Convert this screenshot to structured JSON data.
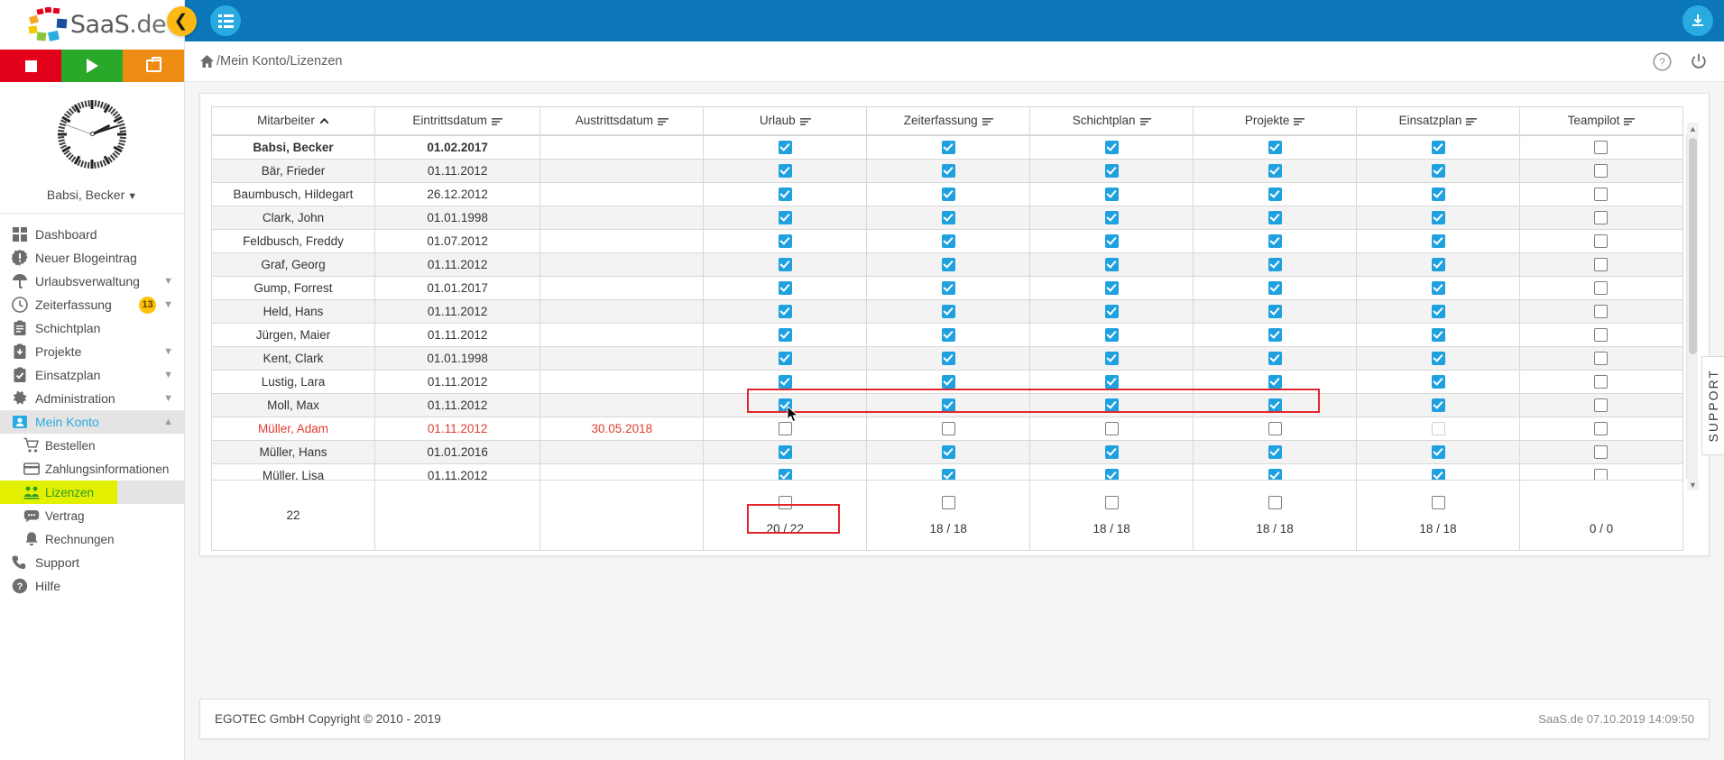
{
  "brand": {
    "name": "SaaS",
    "suffix": ".de"
  },
  "topbar": {
    "collapse_icon": "chevron-left-icon",
    "menu_icon": "list-menu-icon",
    "download_icon": "download-icon"
  },
  "breadcrumb": {
    "home_icon": "home-icon",
    "path": "/Mein Konto/Lizenzen",
    "help_icon": "help-circle-icon",
    "power_icon": "power-icon"
  },
  "sidebar": {
    "action_buttons": [
      {
        "name": "stop-button",
        "icon": "stop-square-icon",
        "color": "#e2001a"
      },
      {
        "name": "play-button",
        "icon": "play-triangle-icon",
        "color": "#2aa82a"
      },
      {
        "name": "briefcase-button",
        "icon": "briefcase-icon",
        "color": "#ef8c13"
      }
    ],
    "clock_icon": "analog-clock-icon",
    "user": "Babsi, Becker",
    "items": [
      {
        "label": "Dashboard",
        "icon": "dashboard-grid-icon",
        "expandable": false,
        "badge": null,
        "active": false,
        "sub": false
      },
      {
        "label": "Neuer Blogeintrag",
        "icon": "gear-alert-icon",
        "expandable": false,
        "badge": null,
        "active": false,
        "sub": false
      },
      {
        "label": "Urlaubsverwaltung",
        "icon": "umbrella-icon",
        "expandable": true,
        "badge": null,
        "active": false,
        "sub": false
      },
      {
        "label": "Zeiterfassung",
        "icon": "clock-icon",
        "expandable": true,
        "badge": "13",
        "active": false,
        "sub": false
      },
      {
        "label": "Schichtplan",
        "icon": "clipboard-icon",
        "expandable": false,
        "badge": null,
        "active": false,
        "sub": false
      },
      {
        "label": "Projekte",
        "icon": "clipboard-down-icon",
        "expandable": true,
        "badge": null,
        "active": false,
        "sub": false
      },
      {
        "label": "Einsatzplan",
        "icon": "clipboard-check-icon",
        "expandable": true,
        "badge": null,
        "active": false,
        "sub": false
      },
      {
        "label": "Administration",
        "icon": "gear-icon",
        "expandable": true,
        "badge": null,
        "active": false,
        "sub": false
      },
      {
        "label": "Mein Konto",
        "icon": "user-card-icon",
        "expandable": true,
        "badge": null,
        "active": true,
        "sub": false
      },
      {
        "label": "Bestellen",
        "icon": "shopping-cart-icon",
        "expandable": false,
        "badge": null,
        "active": false,
        "sub": true
      },
      {
        "label": "Zahlungsinformationen",
        "icon": "credit-card-icon",
        "expandable": false,
        "badge": null,
        "active": false,
        "sub": true
      },
      {
        "label": "Lizenzen",
        "icon": "users-group-icon",
        "expandable": false,
        "badge": null,
        "active": false,
        "sub": true,
        "highlight": true
      },
      {
        "label": "Vertrag",
        "icon": "speech-bubble-icon",
        "expandable": false,
        "badge": null,
        "active": false,
        "sub": true
      },
      {
        "label": "Rechnungen",
        "icon": "bell-icon",
        "expandable": false,
        "badge": null,
        "active": false,
        "sub": true
      },
      {
        "label": "Support",
        "icon": "phone-icon",
        "expandable": false,
        "badge": null,
        "active": false,
        "sub": false
      },
      {
        "label": "Hilfe",
        "icon": "help-circle-icon",
        "expandable": false,
        "badge": null,
        "active": false,
        "sub": false
      }
    ]
  },
  "table": {
    "columns": [
      {
        "label": "Mitarbeiter",
        "sorted": true,
        "sort_dir": "asc"
      },
      {
        "label": "Eintrittsdatum",
        "sorted": false
      },
      {
        "label": "Austrittsdatum",
        "sorted": false
      },
      {
        "label": "Urlaub",
        "sorted": false
      },
      {
        "label": "Zeiterfassung",
        "sorted": false
      },
      {
        "label": "Schichtplan",
        "sorted": false
      },
      {
        "label": "Projekte",
        "sorted": false
      },
      {
        "label": "Einsatzplan",
        "sorted": false
      },
      {
        "label": "Teampilot",
        "sorted": false
      }
    ],
    "rows": [
      {
        "name": "Babsi, Becker",
        "entry": "01.02.2017",
        "exit": "",
        "bold": true,
        "inactive": false,
        "checks": [
          true,
          true,
          true,
          true,
          true,
          false
        ]
      },
      {
        "name": "Bär, Frieder",
        "entry": "01.11.2012",
        "exit": "",
        "bold": false,
        "inactive": false,
        "checks": [
          true,
          true,
          true,
          true,
          true,
          false
        ]
      },
      {
        "name": "Baumbusch, Hildegart",
        "entry": "26.12.2012",
        "exit": "",
        "bold": false,
        "inactive": false,
        "checks": [
          true,
          true,
          true,
          true,
          true,
          false
        ]
      },
      {
        "name": "Clark, John",
        "entry": "01.01.1998",
        "exit": "",
        "bold": false,
        "inactive": false,
        "checks": [
          true,
          true,
          true,
          true,
          true,
          false
        ]
      },
      {
        "name": "Feldbusch, Freddy",
        "entry": "01.07.2012",
        "exit": "",
        "bold": false,
        "inactive": false,
        "checks": [
          true,
          true,
          true,
          true,
          true,
          false
        ]
      },
      {
        "name": "Graf, Georg",
        "entry": "01.11.2012",
        "exit": "",
        "bold": false,
        "inactive": false,
        "checks": [
          true,
          true,
          true,
          true,
          true,
          false
        ]
      },
      {
        "name": "Gump, Forrest",
        "entry": "01.01.2017",
        "exit": "",
        "bold": false,
        "inactive": false,
        "checks": [
          true,
          true,
          true,
          true,
          true,
          false
        ]
      },
      {
        "name": "Held, Hans",
        "entry": "01.11.2012",
        "exit": "",
        "bold": false,
        "inactive": false,
        "checks": [
          true,
          true,
          true,
          true,
          true,
          false
        ]
      },
      {
        "name": "Jürgen, Maier",
        "entry": "01.11.2012",
        "exit": "",
        "bold": false,
        "inactive": false,
        "checks": [
          true,
          true,
          true,
          true,
          true,
          false
        ]
      },
      {
        "name": "Kent, Clark",
        "entry": "01.01.1998",
        "exit": "",
        "bold": false,
        "inactive": false,
        "checks": [
          true,
          true,
          true,
          true,
          true,
          false
        ]
      },
      {
        "name": "Lustig, Lara",
        "entry": "01.11.2012",
        "exit": "",
        "bold": false,
        "inactive": false,
        "checks": [
          true,
          true,
          true,
          true,
          true,
          false
        ]
      },
      {
        "name": "Moll, Max",
        "entry": "01.11.2012",
        "exit": "",
        "bold": false,
        "inactive": false,
        "checks": [
          true,
          true,
          true,
          true,
          true,
          false
        ]
      },
      {
        "name": "Müller, Adam",
        "entry": "01.11.2012",
        "exit": "30.05.2018",
        "bold": false,
        "inactive": true,
        "checks": [
          false,
          false,
          false,
          false,
          false,
          false
        ]
      },
      {
        "name": "Müller, Hans",
        "entry": "01.01.2016",
        "exit": "",
        "bold": false,
        "inactive": false,
        "checks": [
          true,
          true,
          true,
          true,
          true,
          false
        ]
      },
      {
        "name": "Müller, Lisa",
        "entry": "01.11.2012",
        "exit": "",
        "bold": false,
        "inactive": false,
        "checks": [
          true,
          true,
          true,
          true,
          true,
          false
        ]
      }
    ],
    "totals": {
      "employee_count": "22",
      "values": [
        "20 / 22",
        "18 / 18",
        "18 / 18",
        "18 / 18",
        "18 / 18",
        "0 / 0"
      ],
      "highlighted_index": 0
    },
    "selection_highlight_row": "Lustig, Lara",
    "accent_colors": {
      "checked": "#1fa1e0",
      "sort_header": "#fdb913",
      "selection_outline": "#e3262b",
      "inactive_row_text": "#e03b2f",
      "highlight_menu": "#e2f000"
    }
  },
  "support_tab": {
    "label": "SUPPORT"
  },
  "footer": {
    "copyright": "EGOTEC GmbH Copyright © 2010 - 2019",
    "status": "SaaS.de  07.10.2019 14:09:50"
  }
}
